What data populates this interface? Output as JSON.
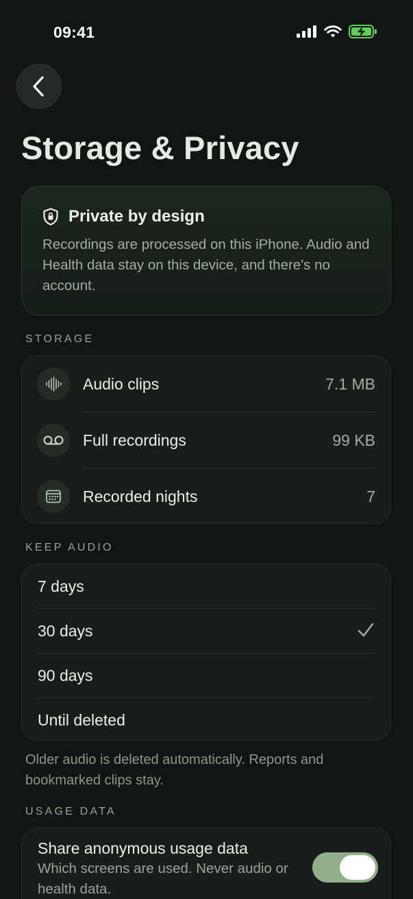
{
  "status_bar": {
    "time": "09:41"
  },
  "header": {
    "title": "Storage & Privacy"
  },
  "privacy_card": {
    "title": "Private by design",
    "body": "Recordings are processed on this iPhone. Audio and Health data stay on this device, and there's no account."
  },
  "storage": {
    "label": "STORAGE",
    "rows": [
      {
        "icon": "waveform-icon",
        "label": "Audio clips",
        "value": "7.1 MB"
      },
      {
        "icon": "voicemail-icon",
        "label": "Full recordings",
        "value": "99 KB"
      },
      {
        "icon": "calendar-icon",
        "label": "Recorded nights",
        "value": "7"
      }
    ]
  },
  "keep_audio": {
    "label": "KEEP AUDIO",
    "options": [
      {
        "label": "7 days",
        "selected": false
      },
      {
        "label": "30 days",
        "selected": true
      },
      {
        "label": "90 days",
        "selected": false
      },
      {
        "label": "Until deleted",
        "selected": false
      }
    ],
    "footnote": "Older audio is deleted automatically. Reports and bookmarked clips stay."
  },
  "usage_data": {
    "label": "USAGE DATA",
    "title": "Share anonymous usage data",
    "description": "Which screens are used. Never audio or health data.",
    "enabled": true
  },
  "colors": {
    "background": "#121513",
    "accent": "#90b089",
    "battery": "#5fcf5a"
  }
}
